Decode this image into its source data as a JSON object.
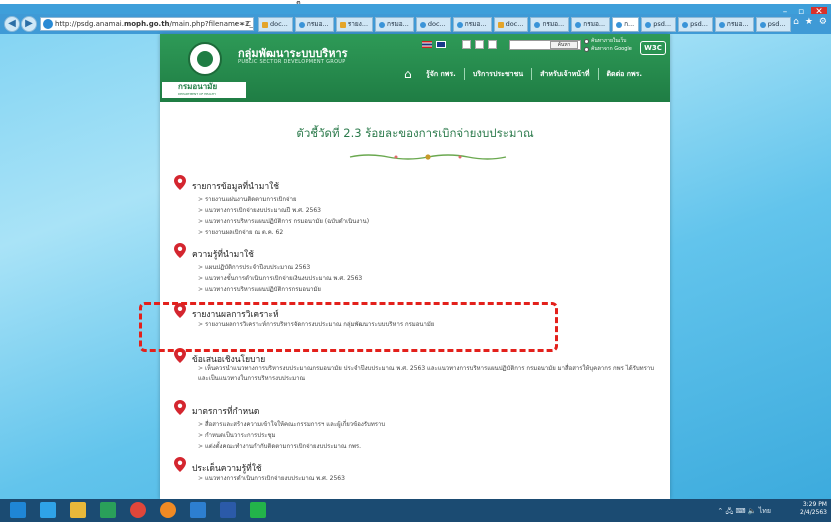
{
  "window": {
    "top_glyph": "ๆ",
    "controls": [
      "–",
      "▫",
      "✕"
    ]
  },
  "browser": {
    "url_prefix": "http://psdg.anamai.",
    "url_bold": "moph.go.th",
    "url_rest": "/main.php?filename=2_3",
    "url_tools": "⌕ ▾ C",
    "tabs": [
      {
        "label": "doc...",
        "kind": "doc",
        "active": false
      },
      {
        "label": "กรมอ...",
        "kind": "ie",
        "active": false
      },
      {
        "label": "รายง...",
        "kind": "doc",
        "active": false
      },
      {
        "label": "กรมอ...",
        "kind": "ie",
        "active": false
      },
      {
        "label": "doc...",
        "kind": "ie",
        "active": false
      },
      {
        "label": "กรมอ...",
        "kind": "ie",
        "active": false
      },
      {
        "label": "doc...",
        "kind": "doc",
        "active": false
      },
      {
        "label": "กรมอ...",
        "kind": "ie",
        "active": false
      },
      {
        "label": "กรมอ...",
        "kind": "ie",
        "active": false
      },
      {
        "label": "ก...",
        "kind": "ie",
        "active": true
      },
      {
        "label": "psd...",
        "kind": "ie",
        "active": false
      },
      {
        "label": "psd...",
        "kind": "ie",
        "active": false
      },
      {
        "label": "กรมอ...",
        "kind": "ie",
        "active": false
      },
      {
        "label": "psd...",
        "kind": "ie",
        "active": false
      }
    ]
  },
  "site": {
    "org_label": "กรมอนามัย",
    "org_sub": "DEPARTMENT OF HEALTH",
    "title": "กลุ่มพัฒนาระบบบริหาร",
    "subtitle": "PUBLIC SECTOR DEVELOPMENT GROUP",
    "search_button": "ค้นหา",
    "search_opt1": "ค้นหาภายในเว็บ",
    "search_opt2": "ค้นหาจาก Google",
    "w3c": "W3C",
    "menu": [
      "รู้จัก กพร.",
      "บริการประชาชน",
      "สำหรับเจ้าหน้าที่",
      "ติดต่อ กพร."
    ]
  },
  "content": {
    "page_title": "ตัวชี้วัดที่ 2.3 ร้อยละของการเบิกจ่ายงบประมาณ",
    "sections": [
      {
        "title": "รายการข้อมูลที่นำมาใช้",
        "items": [
          "รายงานแผ่นงานติดตามการเบิกจ่าย",
          "แนวทางการเบิกจ่ายงบประมาณปี พ.ศ. 2563",
          "แนวทางการบริหารแผนปฏิบัติการ กรมอนามัย (ฉบับดำเนินงาน)",
          "รายงานผลเบิกจ่าย ณ ต.ค. 62"
        ]
      },
      {
        "title": "ความรู้ที่นำมาใช้",
        "items": [
          "แผนปฏิบัติการประจำปีงบประมาณ 2563",
          "แนวทางขั้นการดำเนินการเบิกจ่ายเงินงบประมาณ พ.ศ. 2563",
          "แนวทางการบริหารแผนปฏิบัติการกรมอนามัย"
        ]
      },
      {
        "title": "รายงานผลการวิเคราะห์",
        "items": [
          "รายงานผลการวิเคราะห์การบริหารจัดการงบประมาณ กลุ่มพัฒนาระบบบริหาร กรมอนามัย"
        ]
      },
      {
        "title": "ข้อเสนอเชิงนโยบาย",
        "items": [
          "เห็นควรนำแนวทางการบริหารงบประมาณกรมอนามัย ประจำปีงบประมาณ พ.ศ. 2563 และแนวทางการบริหารแผนปฏิบัติการ กรมอนามัย มาสื่อสารให้บุคลากร กพร ได้รับทราบและเป็นแนวทางในการบริหารงบประมาณ"
        ]
      },
      {
        "title": "มาตรการที่กำหนด",
        "items": [
          "สื่อสารและสร้างความเข้าใจให้คณะกรรมการฯ และผู้เกี่ยวข้องรับทราบ",
          "กำหนดเป็นวาระการประชุม",
          "แต่งตั้งคณะทำงานกำกับติดตามการเบิกจ่ายงบประมาณ กพร."
        ]
      },
      {
        "title": "ประเด็นความรู้ที่ใช้",
        "items": [
          "แนวทางการดำเนินการเบิกจ่ายงบประมาณ พ.ศ. 2563"
        ]
      }
    ]
  },
  "taskbar": {
    "time": "3:29 PM",
    "date": "2/4/2563",
    "tray": "⌃ 🖧 ⌨ 🔈 ไทย",
    "apps": [
      "windows",
      "ie",
      "explorer",
      "store",
      "chrome",
      "media",
      "paint",
      "word",
      "line"
    ]
  },
  "colors": {
    "brand_green": "#1f7d44",
    "callout_red": "#e3201b",
    "pin_red": "#d4262f",
    "title_green": "#2b7a4b"
  }
}
